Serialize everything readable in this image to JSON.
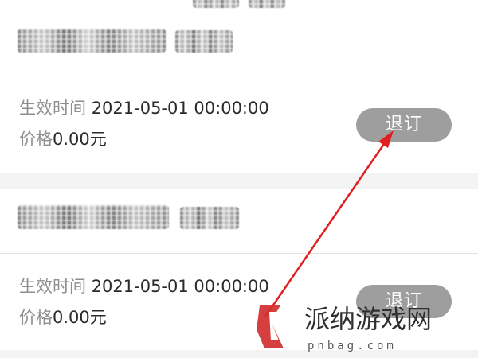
{
  "packages": [
    {
      "effective_label": "生效时间",
      "effective_value": "2021-05-01 00:00:00",
      "price_label": "价格",
      "price_value": "0.00元",
      "unsubscribe_label": "退订"
    },
    {
      "effective_label": "生效时间",
      "effective_value": "2021-05-01 00:00:00",
      "price_label": "价格",
      "price_value": "0.00元",
      "unsubscribe_label": "退订"
    }
  ],
  "watermark": {
    "text": "派纳游戏网",
    "url": "pnbag.com",
    "accent": "#d32f2f"
  },
  "annotation_color": "#e02020"
}
